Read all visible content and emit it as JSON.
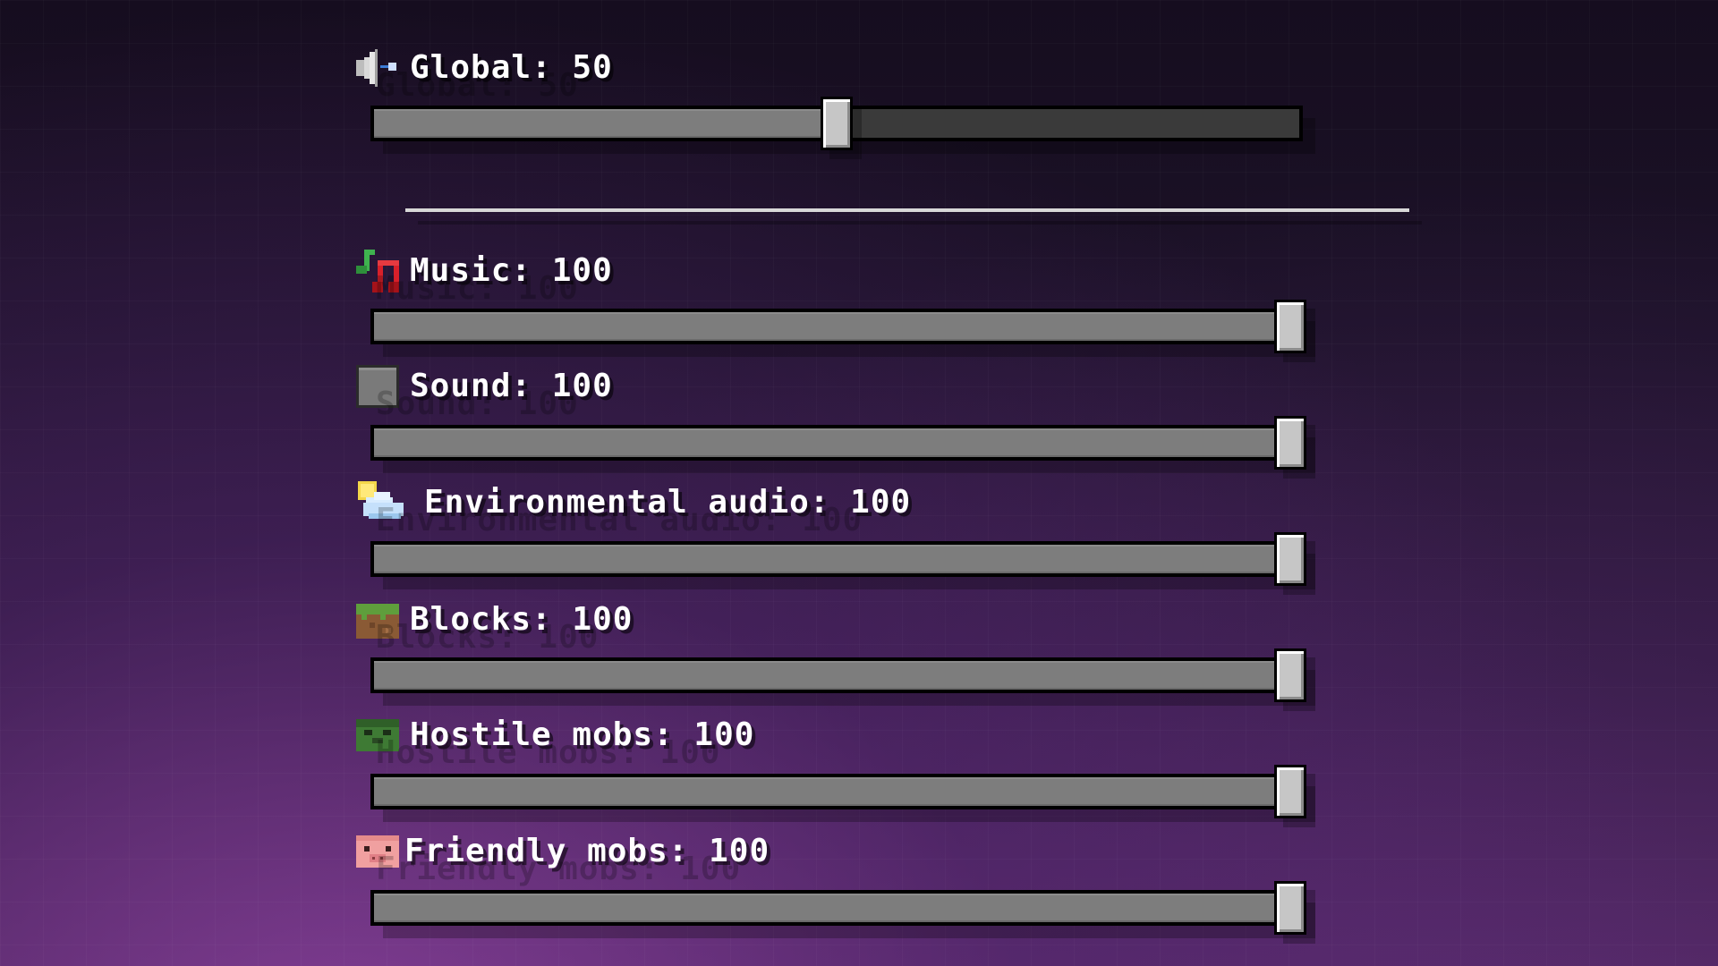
{
  "global": {
    "label": "Global: 50",
    "value": 50,
    "icon": "speaker-icon"
  },
  "categories": [
    {
      "id": "music",
      "label": "Music: 100",
      "value": 100,
      "icon": "music-notes-icon"
    },
    {
      "id": "sound",
      "label": "Sound: 100",
      "value": 100,
      "icon": "gray-block-icon"
    },
    {
      "id": "environment",
      "label": "Environmental audio: 100",
      "value": 100,
      "icon": "sun-cloud-icon"
    },
    {
      "id": "blocks",
      "label": "Blocks: 100",
      "value": 100,
      "icon": "grass-block-icon"
    },
    {
      "id": "hostile",
      "label": "Hostile mobs: 100",
      "value": 100,
      "icon": "zombie-head-icon"
    },
    {
      "id": "friendly",
      "label": "Friendly mobs: 100",
      "value": 100,
      "icon": "pig-head-icon"
    }
  ],
  "colors": {
    "slider_fill": "#7d7d7d",
    "slider_empty": "#3a3a3a",
    "knob": "#c6c6c6",
    "divider": "#d8d8d8"
  }
}
